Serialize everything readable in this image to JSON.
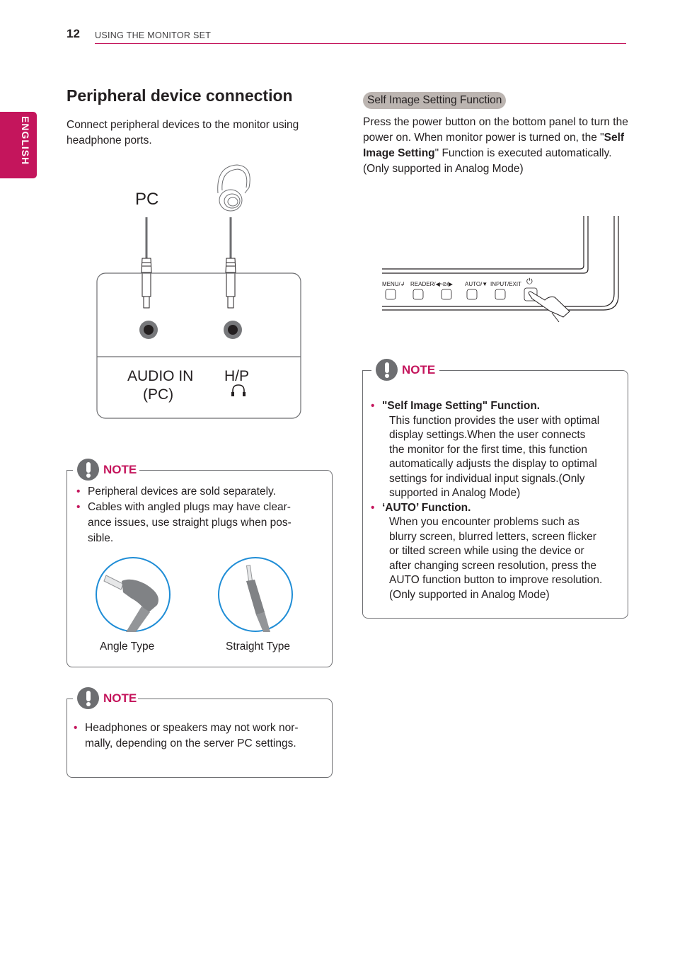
{
  "header": {
    "page_number": "12",
    "section": "USING THE MONITOR SET"
  },
  "language_tab": "ENGLISH",
  "left": {
    "title": "Peripheral device connection",
    "intro": "Connect peripheral devices to the monitor using headphone ports.",
    "diagram": {
      "pc_label": "PC",
      "audio_in_line1": "AUDIO IN",
      "audio_in_line2": "(PC)",
      "hp_label": "H/P",
      "icons": [
        "headphones-icon",
        "headphone-port-icon"
      ]
    },
    "note1": {
      "label": "NOTE",
      "bullets": [
        "Peripheral devices are sold separately.",
        "Cables with angled plugs may have clear-ance issues, use straight plugs when pos-sible."
      ],
      "bullet_lines": [
        [
          "Peripheral devices are sold separately."
        ],
        [
          "Cables with angled plugs may have clear-",
          "ance issues, use straight plugs when pos-",
          "sible."
        ]
      ],
      "images": [
        {
          "caption": "Angle Type"
        },
        {
          "caption": "Straight Type"
        }
      ]
    },
    "note2": {
      "label": "NOTE",
      "bullet_lines": [
        "Headphones or speakers may not work nor-",
        "mally, depending on the server PC settings."
      ]
    }
  },
  "right": {
    "pill": "Self Image Setting Function",
    "para_part1": "Press the power button on the bottom panel to turn the power on. When monitor power is turned on, the \"",
    "para_bold": "Self Image Setting",
    "para_part2": "\" Function is executed automatically. (Only supported in Analog Mode)",
    "monitor_buttons": [
      "MENU/↲",
      "READER/◀",
      "◔⊘/▶",
      "AUTO/▼",
      "INPUT/EXIT",
      "⏻"
    ],
    "note": {
      "label": "NOTE",
      "items": [
        {
          "title": "\"Self Image Setting\" Function.",
          "lines": [
            "This function provides the user with optimal",
            "display settings.When the user connects",
            "the monitor for the first time, this function",
            "automatically adjusts the display to optimal",
            "settings for individual input signals.(Only",
            "supported in Analog Mode)"
          ]
        },
        {
          "title": "‘AUTO’ Function.",
          "lines": [
            "When you encounter problems such as",
            "blurry screen, blurred letters, screen flicker",
            "or tilted screen while using the device or",
            "after changing screen resolution, press the",
            "AUTO function button to improve resolution.",
            "(Only supported in Analog Mode)"
          ]
        }
      ]
    }
  },
  "colors": {
    "accent": "#c4155c",
    "note_icon": "#6d6e71",
    "pill_bg": "#bcb5b1",
    "circle_blue": "#1f8dd6"
  }
}
